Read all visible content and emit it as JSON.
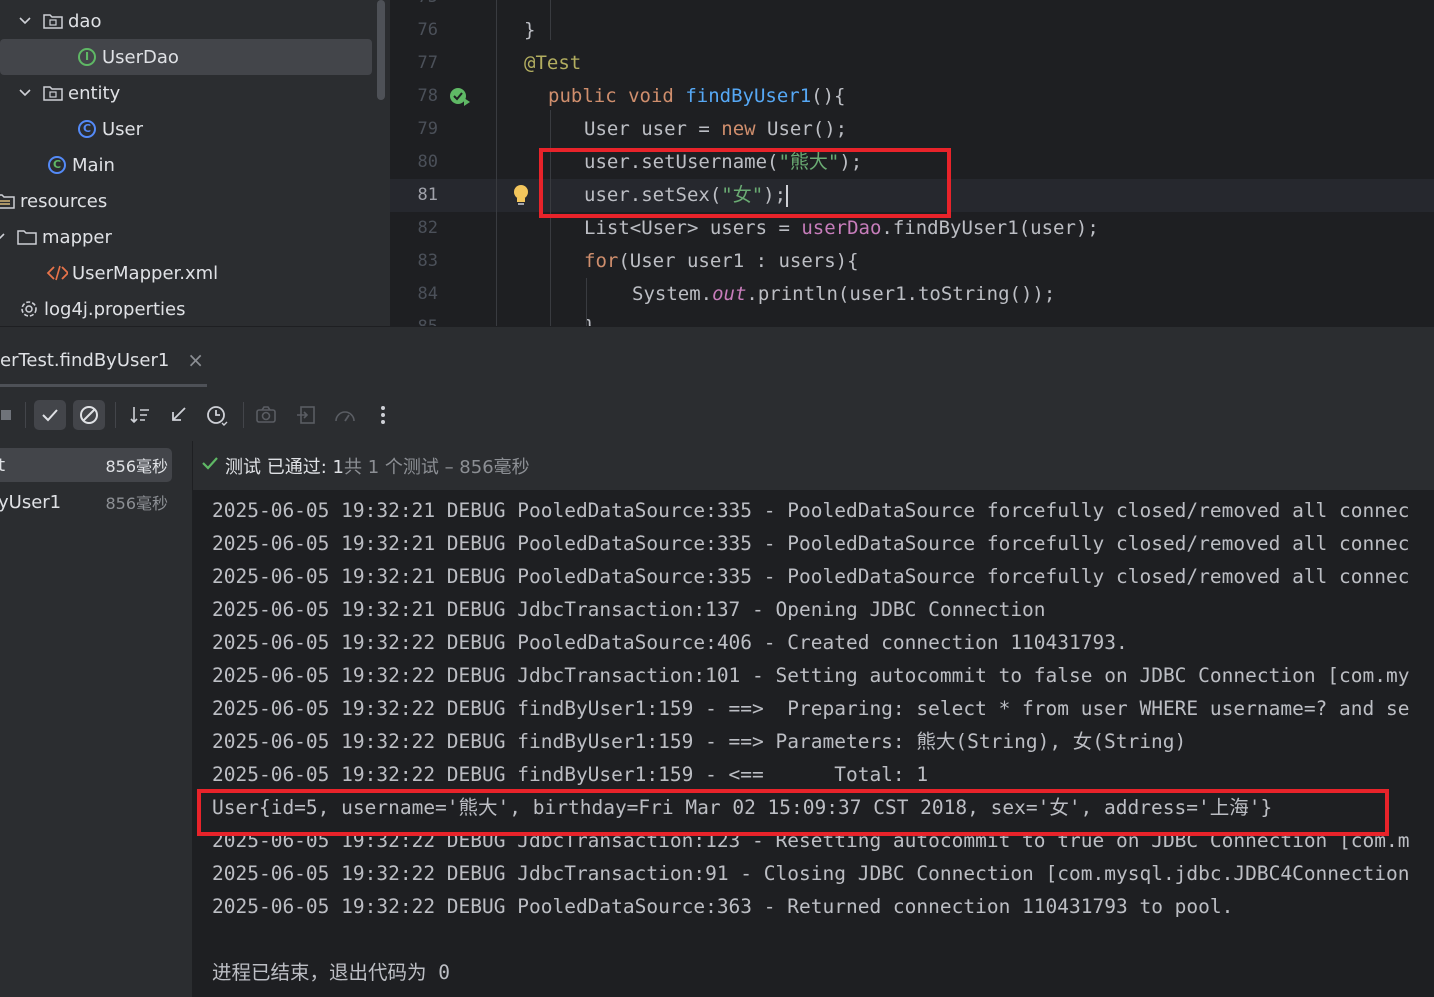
{
  "project_tree": {
    "items": [
      {
        "label": "dao",
        "icon": "folder-icon",
        "expanded": true
      },
      {
        "label": "UserDao",
        "icon": "interface-icon",
        "selected": true
      },
      {
        "label": "entity",
        "icon": "folder-icon",
        "expanded": true
      },
      {
        "label": "User",
        "icon": "class-icon"
      },
      {
        "label": "Main",
        "icon": "main-class-icon"
      },
      {
        "label": "resources",
        "icon": "resources-folder-icon"
      },
      {
        "label": "mapper",
        "icon": "folder-icon",
        "expanded": true
      },
      {
        "label": "UserMapper.xml",
        "icon": "xml-file-icon"
      },
      {
        "label": "log4j.properties",
        "icon": "properties-file-icon"
      }
    ]
  },
  "editor": {
    "current_line": 81,
    "lines": [
      {
        "num": "76",
        "text": "}"
      },
      {
        "num": "77",
        "annotation": "@Test"
      },
      {
        "num": "78",
        "kw1": "public",
        "kw2": "void",
        "fn": "findByUser1",
        "rest": "(){"
      },
      {
        "num": "79",
        "a": "User user = ",
        "kw": "new",
        "b": " User();"
      },
      {
        "num": "80",
        "a": "user.setUsername(",
        "str": "\"熊大\"",
        "b": ");"
      },
      {
        "num": "81",
        "a": "user.setSex(",
        "str": "\"女\"",
        "b": ");"
      },
      {
        "num": "82",
        "a": "List<User> users = ",
        "fld": "userDao",
        "b": ".findByUser1(user);"
      },
      {
        "num": "83",
        "kw": "for",
        "b": "(User user1 : users){"
      },
      {
        "num": "84",
        "a": "System.",
        "fld": "out",
        "b": ".println(user1.toString());"
      }
    ]
  },
  "run_tab": {
    "label": "erTest.findByUser1",
    "close": "×"
  },
  "test_tree": {
    "rows": [
      {
        "label": "t",
        "time": "856毫秒"
      },
      {
        "label": "yUser1",
        "time": "856毫秒"
      }
    ]
  },
  "status": {
    "passed": "测试 已通过: 1",
    "detail": "共 1 个测试 – 856毫秒"
  },
  "console": {
    "lines": [
      "2025-06-05 19:32:21 DEBUG PooledDataSource:335 - PooledDataSource forcefully closed/removed all connec",
      "2025-06-05 19:32:21 DEBUG PooledDataSource:335 - PooledDataSource forcefully closed/removed all connec",
      "2025-06-05 19:32:21 DEBUG PooledDataSource:335 - PooledDataSource forcefully closed/removed all connec",
      "2025-06-05 19:32:21 DEBUG JdbcTransaction:137 - Opening JDBC Connection",
      "2025-06-05 19:32:22 DEBUG PooledDataSource:406 - Created connection 110431793.",
      "2025-06-05 19:32:22 DEBUG JdbcTransaction:101 - Setting autocommit to false on JDBC Connection [com.my",
      "2025-06-05 19:32:22 DEBUG findByUser1:159 - ==>  Preparing: select * from user WHERE username=? and se",
      "2025-06-05 19:32:22 DEBUG findByUser1:159 - ==> Parameters: 熊大(String), 女(String)",
      "2025-06-05 19:32:22 DEBUG findByUser1:159 - <==      Total: 1",
      "User{id=5, username='熊大', birthday=Fri Mar 02 15:09:37 CST 2018, sex='女', address='上海'}",
      "2025-06-05 19:32:22 DEBUG JdbcTransaction:123 - Resetting autocommit to true on JDBC Connection [com.m",
      "2025-06-05 19:32:22 DEBUG JdbcTransaction:91 - Closing JDBC Connection [com.mysql.jdbc.JDBC4Connection",
      "2025-06-05 19:32:22 DEBUG PooledDataSource:363 - Returned connection 110431793 to pool.",
      "",
      "进程已结束，退出代码为 0"
    ]
  },
  "colors": {
    "highlight_box": "#e8232a",
    "pass": "#5fb865"
  }
}
